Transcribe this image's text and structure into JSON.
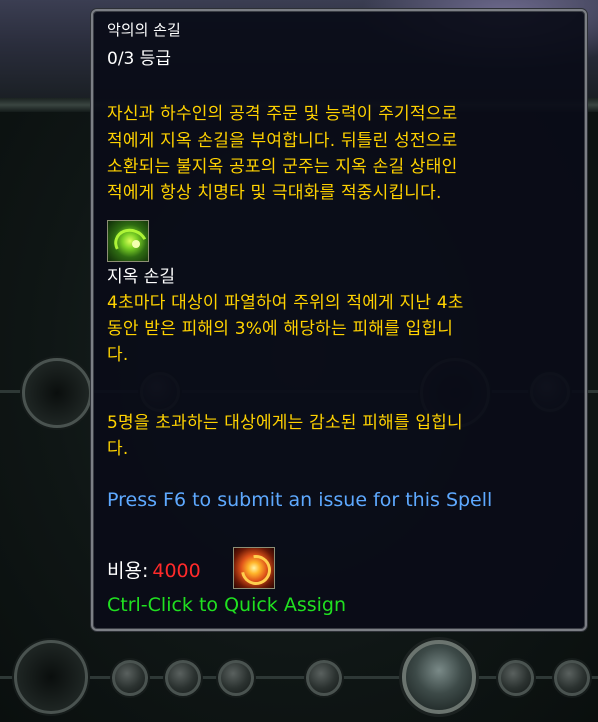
{
  "tooltip": {
    "title": "악의의 손길",
    "rank": "0/3 등급",
    "description_lines": [
      "자신과 하수인의 공격 주문 및 능력이 주기적으로",
      "적에게 지옥 손길을 부여합니다. 뒤틀린 성전으로",
      "소환되는 불지옥 공포의 군주는 지옥 손길 상태인",
      "적에게 항상 치명타 및 극대화를 적중시킵니다."
    ],
    "spell_icon": "fel-swirl-icon",
    "spell_name": "지옥 손길",
    "spell_lines": [
      "4초마다 대상이 파열하여 주위의 적에게 지난 4초",
      "동안 받은 피해의 3%에 해당하는 피해를 입힙니",
      "다."
    ],
    "extra_lines": [
      "5명을 초과하는 대상에게는 감소된 피해를 입힙니",
      "다."
    ],
    "issue_text": "Press F6 to submit an issue for this Spell",
    "cost_label": "비용:",
    "cost_value": "4000",
    "cost_icon": "fire-vortex-icon",
    "quick_assign": "Ctrl-Click to Quick Assign"
  },
  "colors": {
    "description": "#ffd200",
    "title": "#ffffff",
    "issue": "#5ea9ff",
    "cost_value": "#ff2a2a",
    "quick_assign": "#20e020"
  }
}
